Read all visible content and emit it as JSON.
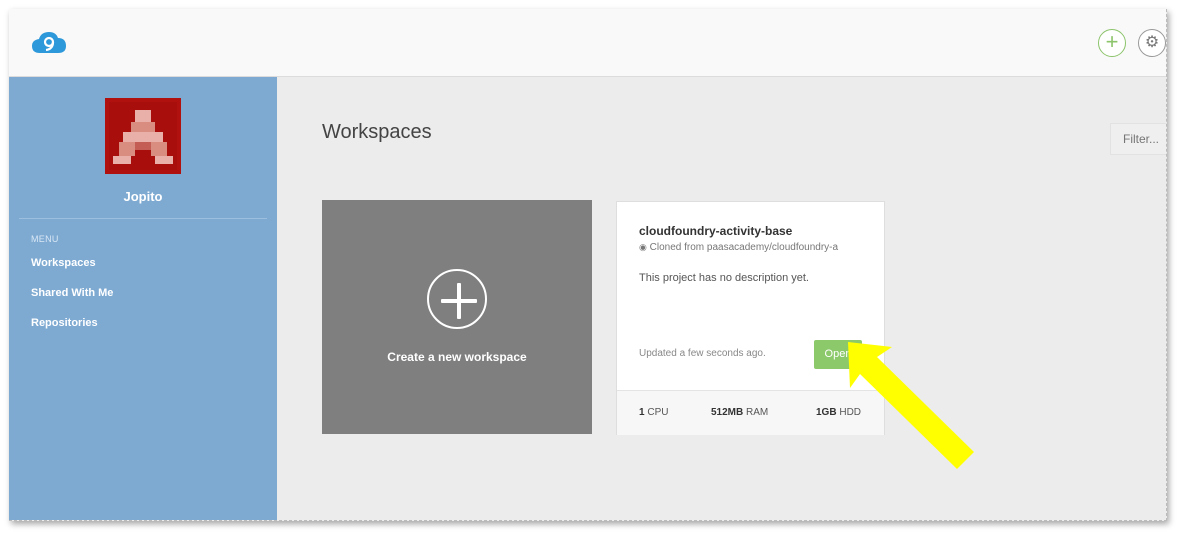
{
  "header": {
    "logo_icon": "cloud9-logo-icon",
    "add_icon": "plus-icon",
    "settings_icon": "gear-icon",
    "brand_color": "#2d98da",
    "accent_color": "#8cc46b"
  },
  "sidebar": {
    "username": "Jopito",
    "menu_heading": "MENU",
    "items": [
      {
        "label": "Workspaces"
      },
      {
        "label": "Shared With Me"
      },
      {
        "label": "Repositories"
      }
    ],
    "background": "#7eaad2"
  },
  "main": {
    "title": "Workspaces",
    "filter_placeholder": "Filter...",
    "create_card": {
      "label": "Create a new workspace",
      "icon": "plus-circle-icon"
    },
    "workspace": {
      "name": "cloudfoundry-activity-base",
      "cloned_from": "Cloned from paasacademy/cloudfoundry-a",
      "description": "This project has no description yet.",
      "updated": "Updated a few seconds ago.",
      "open_label": "Open",
      "cpu_value": "1",
      "cpu_unit": "CPU",
      "ram_value": "512MB",
      "ram_unit": "RAM",
      "hdd_value": "1GB",
      "hdd_unit": "HDD"
    }
  },
  "annotation": {
    "arrow_icon": "yellow-arrow-icon",
    "arrow_color": "#ffff00"
  }
}
